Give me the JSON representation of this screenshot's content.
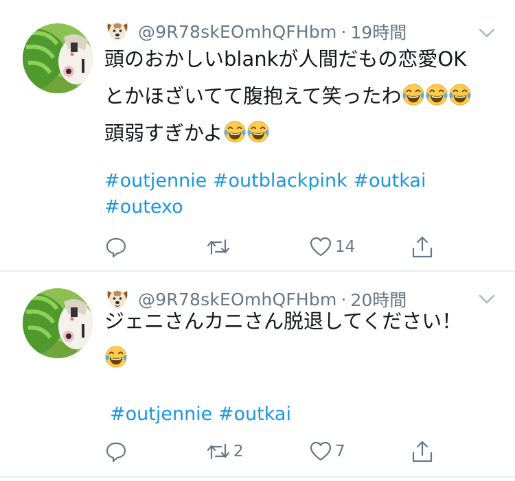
{
  "tweets": [
    {
      "avatar_icon": "green-character-avatar",
      "author_icon": "dog-face-icon",
      "handle": "@9R78skEOmhQFHbm",
      "separator": "·",
      "time": "19時間",
      "lines": [
        "頭のおかしいblankが人間だもの恋愛OK",
        "とかほざいてて腹抱えて笑ったわ",
        "頭弱すぎかよ"
      ],
      "line_emoji_counts": [
        0,
        3,
        2
      ],
      "hashtags": [
        "#outjennie",
        "#outblackpink",
        "#outkai",
        "#outexo"
      ],
      "actions": {
        "reply_count": "",
        "retweet_count": "",
        "like_count": "14",
        "share_label": ""
      }
    },
    {
      "avatar_icon": "green-character-avatar",
      "author_icon": "dog-face-icon",
      "handle": "@9R78skEOmhQFHbm",
      "separator": "·",
      "time": "20時間",
      "lines": [
        "ジェニさんカニさん脱退してください！"
      ],
      "line_emoji_counts": [
        0,
        1
      ],
      "hashtags": [
        "#outjennie",
        "#outkai"
      ],
      "actions": {
        "reply_count": "",
        "retweet_count": "2",
        "like_count": "7",
        "share_label": ""
      }
    }
  ],
  "emoji_name": "face-with-tears-of-joy",
  "colors": {
    "text": "#14171a",
    "secondary": "#657786",
    "link": "#1b95e0",
    "divider": "#e6ecf0"
  }
}
